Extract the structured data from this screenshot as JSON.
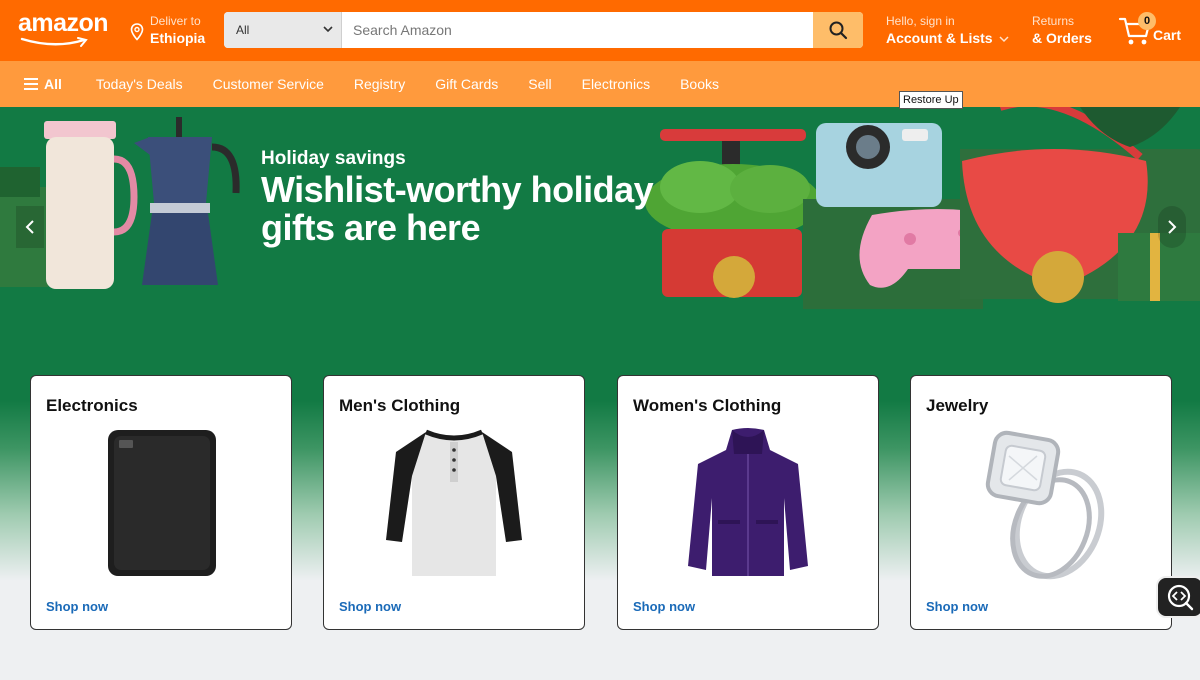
{
  "header": {
    "logo": "amazon",
    "deliver_label": "Deliver to",
    "deliver_location": "Ethiopia",
    "search_category": "All",
    "search_placeholder": "Search Amazon",
    "account_greeting": "Hello, sign in",
    "account_label": "Account & Lists",
    "returns_label": "Returns",
    "orders_label": "& Orders",
    "cart_count": "0",
    "cart_label": "Cart",
    "icons": {
      "location": "location-pin-icon",
      "search": "search-icon",
      "cart": "cart-icon",
      "dropdown": "chevron-down-icon"
    }
  },
  "nav": {
    "all_label": "All",
    "items": [
      "Today's Deals",
      "Customer Service",
      "Registry",
      "Gift Cards",
      "Sell",
      "Electronics",
      "Books"
    ]
  },
  "tooltip": "Restore Up",
  "hero": {
    "eyebrow": "Holiday savings",
    "title": "Wishlist-worthy holiday gifts are here",
    "prev_icon": "chevron-left-icon",
    "next_icon": "chevron-right-icon"
  },
  "cards": [
    {
      "title": "Electronics",
      "link": "Shop now"
    },
    {
      "title": "Men's Clothing",
      "link": "Shop now"
    },
    {
      "title": "Women's Clothing",
      "link": "Shop now"
    },
    {
      "title": "Jewelry",
      "link": "Shop now"
    }
  ],
  "colors": {
    "header": "#ff6a00",
    "nav": "#ff9a3d",
    "hero": "#127a44",
    "search_button": "#febd69",
    "link": "#1a6ab8"
  }
}
